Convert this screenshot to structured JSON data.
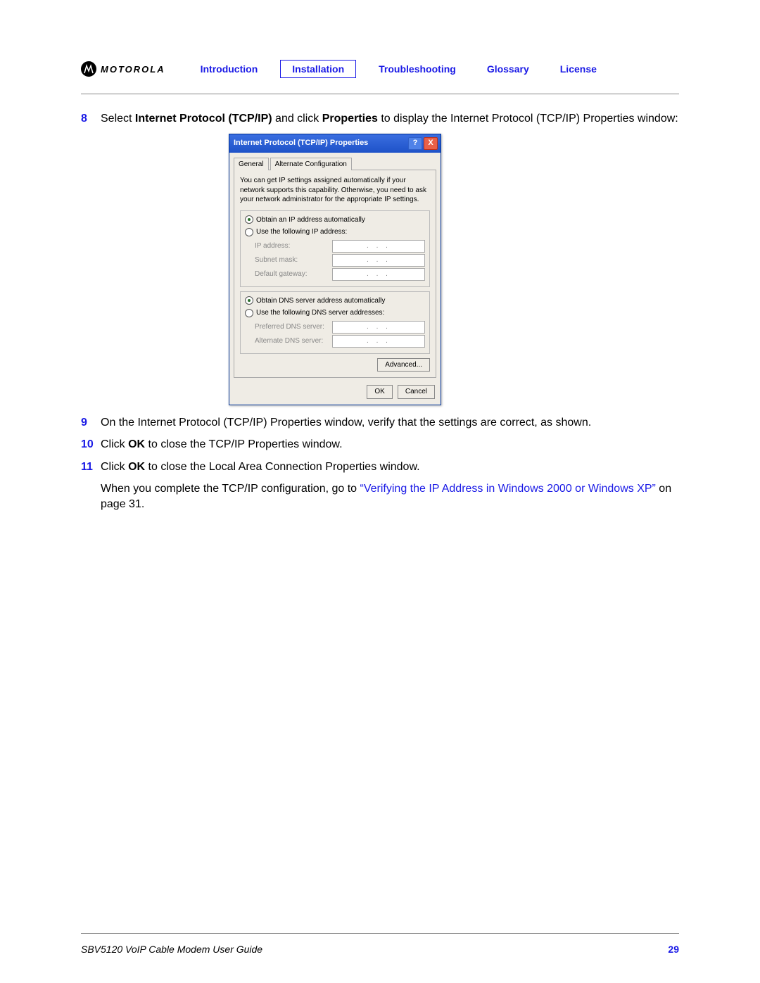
{
  "header": {
    "brand": "MOTOROLA",
    "nav": [
      {
        "label": "Introduction",
        "active": false
      },
      {
        "label": "Installation",
        "active": true
      },
      {
        "label": "Troubleshooting",
        "active": false
      },
      {
        "label": "Glossary",
        "active": false
      },
      {
        "label": "License",
        "active": false
      }
    ]
  },
  "steps": {
    "s8": {
      "num": "8",
      "pre": "Select ",
      "b1": "Internet Protocol (TCP/IP)",
      "mid": " and click ",
      "b2": "Properties",
      "post": " to display the Internet Protocol (TCP/IP) Properties window:"
    },
    "s9": {
      "num": "9",
      "text": "On the Internet Protocol (TCP/IP) Properties window, verify that the settings are correct, as shown."
    },
    "s10": {
      "num": "10",
      "pre": "Click ",
      "b": "OK",
      "post": " to close the TCP/IP Properties window."
    },
    "s11": {
      "num": "11",
      "pre": "Click ",
      "b": "OK",
      "post": " to close the Local Area Connection Properties window."
    },
    "final": {
      "pre": "When you complete the TCP/IP configuration, go to ",
      "link": "“Verifying the IP Address in Windows 2000 or Windows XP”",
      "post": " on page 31."
    }
  },
  "dialog": {
    "title": "Internet Protocol (TCP/IP) Properties",
    "tabs": {
      "general": "General",
      "alt": "Alternate Configuration"
    },
    "info": "You can get IP settings assigned automatically if your network supports this capability. Otherwise, you need to ask your network administrator for the appropriate IP settings.",
    "radios": {
      "obtain_ip": "Obtain an IP address automatically",
      "use_ip": "Use the following IP address:",
      "obtain_dns": "Obtain DNS server address automatically",
      "use_dns": "Use the following DNS server addresses:"
    },
    "fields": {
      "ip": "IP address:",
      "subnet": "Subnet mask:",
      "gateway": "Default gateway:",
      "pref_dns": "Preferred DNS server:",
      "alt_dns": "Alternate DNS server:"
    },
    "dots": ". . .",
    "buttons": {
      "advanced": "Advanced...",
      "ok": "OK",
      "cancel": "Cancel"
    }
  },
  "footer": {
    "title": "SBV5120 VoIP Cable Modem User Guide",
    "page": "29"
  }
}
